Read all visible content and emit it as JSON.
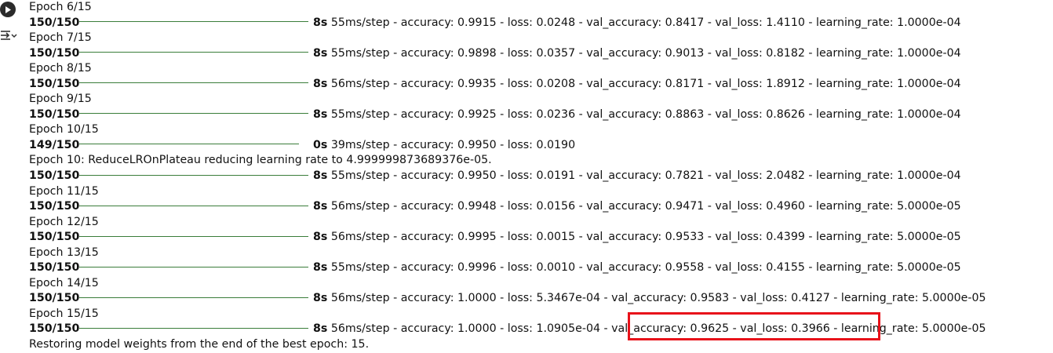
{
  "cell": {
    "run_icon": "play-icon",
    "toggle_icon": "output-toggle-icon"
  },
  "output_lines": [
    {
      "kind": "text",
      "text": "Epoch 6/15"
    },
    {
      "kind": "progress",
      "steps": "150/150",
      "time": "8s",
      "rest": " 55ms/step - accuracy: 0.9915 - loss: 0.0248 - val_accuracy: 0.8417 - val_loss: 1.4110 - learning_rate: 1.0000e-04"
    },
    {
      "kind": "text",
      "text": "Epoch 7/15"
    },
    {
      "kind": "progress",
      "steps": "150/150",
      "time": "8s",
      "rest": " 55ms/step - accuracy: 0.9898 - loss: 0.0357 - val_accuracy: 0.9013 - val_loss: 0.8182 - learning_rate: 1.0000e-04"
    },
    {
      "kind": "text",
      "text": "Epoch 8/15"
    },
    {
      "kind": "progress",
      "steps": "150/150",
      "time": "8s",
      "rest": " 56ms/step - accuracy: 0.9935 - loss: 0.0208 - val_accuracy: 0.8171 - val_loss: 1.8912 - learning_rate: 1.0000e-04"
    },
    {
      "kind": "text",
      "text": "Epoch 9/15"
    },
    {
      "kind": "progress",
      "steps": "150/150",
      "time": "8s",
      "rest": " 55ms/step - accuracy: 0.9925 - loss: 0.0236 - val_accuracy: 0.8863 - val_loss: 0.8626 - learning_rate: 1.0000e-04"
    },
    {
      "kind": "text",
      "text": "Epoch 10/15"
    },
    {
      "kind": "progress",
      "partial": true,
      "steps": "149/150",
      "time": "0s",
      "rest": " 39ms/step - accuracy: 0.9950 - loss: 0.0190"
    },
    {
      "kind": "text",
      "text": "Epoch 10: ReduceLROnPlateau reducing learning rate to 4.999999873689376e-05."
    },
    {
      "kind": "progress",
      "steps": "150/150",
      "time": "8s",
      "rest": " 55ms/step - accuracy: 0.9950 - loss: 0.0191 - val_accuracy: 0.7821 - val_loss: 2.0482 - learning_rate: 1.0000e-04"
    },
    {
      "kind": "text",
      "text": "Epoch 11/15"
    },
    {
      "kind": "progress",
      "steps": "150/150",
      "time": "8s",
      "rest": " 56ms/step - accuracy: 0.9948 - loss: 0.0156 - val_accuracy: 0.9471 - val_loss: 0.4960 - learning_rate: 5.0000e-05"
    },
    {
      "kind": "text",
      "text": "Epoch 12/15"
    },
    {
      "kind": "progress",
      "steps": "150/150",
      "time": "8s",
      "rest": " 56ms/step - accuracy: 0.9995 - loss: 0.0015 - val_accuracy: 0.9533 - val_loss: 0.4399 - learning_rate: 5.0000e-05"
    },
    {
      "kind": "text",
      "text": "Epoch 13/15"
    },
    {
      "kind": "progress",
      "steps": "150/150",
      "time": "8s",
      "rest": " 55ms/step - accuracy: 0.9996 - loss: 0.0010 - val_accuracy: 0.9558 - val_loss: 0.4155 - learning_rate: 5.0000e-05"
    },
    {
      "kind": "text",
      "text": "Epoch 14/15"
    },
    {
      "kind": "progress",
      "steps": "150/150",
      "time": "8s",
      "rest": " 56ms/step - accuracy: 1.0000 - loss: 5.3467e-04 - val_accuracy: 0.9583 - val_loss: 0.4127 - learning_rate: 5.0000e-05"
    },
    {
      "kind": "text",
      "text": "Epoch 15/15"
    },
    {
      "kind": "progress",
      "steps": "150/150",
      "time": "8s",
      "rest": " 56ms/step - accuracy: 1.0000 - loss: 1.0905e-04 - val_accuracy: 0.9625 - val_loss: 0.3966 - learning_rate: 5.0000e-05"
    },
    {
      "kind": "text",
      "text": "Restoring model weights from the end of the best epoch: 15."
    }
  ],
  "highlight": {
    "color": "#e8121a",
    "target": "val_accuracy: 0.9625 - val_loss: 0.3966"
  },
  "colors": {
    "progress_bar": "#3a7d3a",
    "run_button": "#2b2b2b"
  }
}
